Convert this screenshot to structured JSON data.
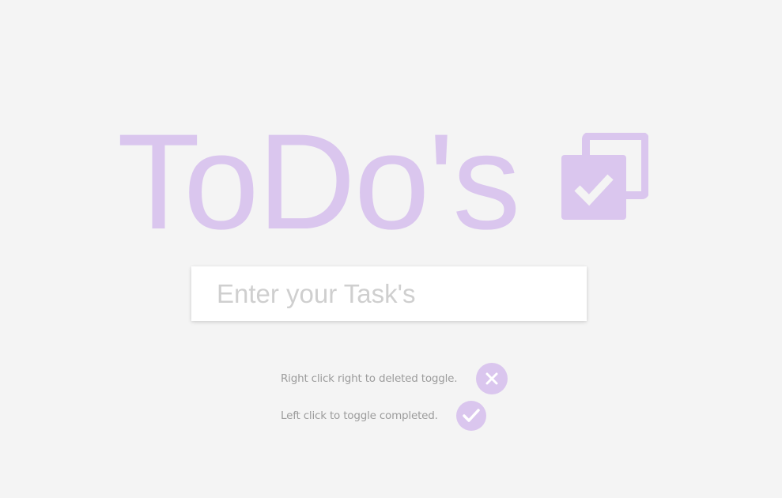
{
  "header": {
    "title": "ToDo's",
    "logo_icon": "checked-checkbox-icon"
  },
  "task_input": {
    "placeholder": "Enter your Task's",
    "value": ""
  },
  "hints": [
    {
      "text": "Right click right to deleted toggle.",
      "icon": "close-icon"
    },
    {
      "text": "Left click to toggle completed.",
      "icon": "check-icon"
    }
  ],
  "colors": {
    "accent": "#dac6ee",
    "background": "#f4f4f4",
    "hint_text": "#9c9c9c",
    "placeholder": "#cfcfcf"
  }
}
